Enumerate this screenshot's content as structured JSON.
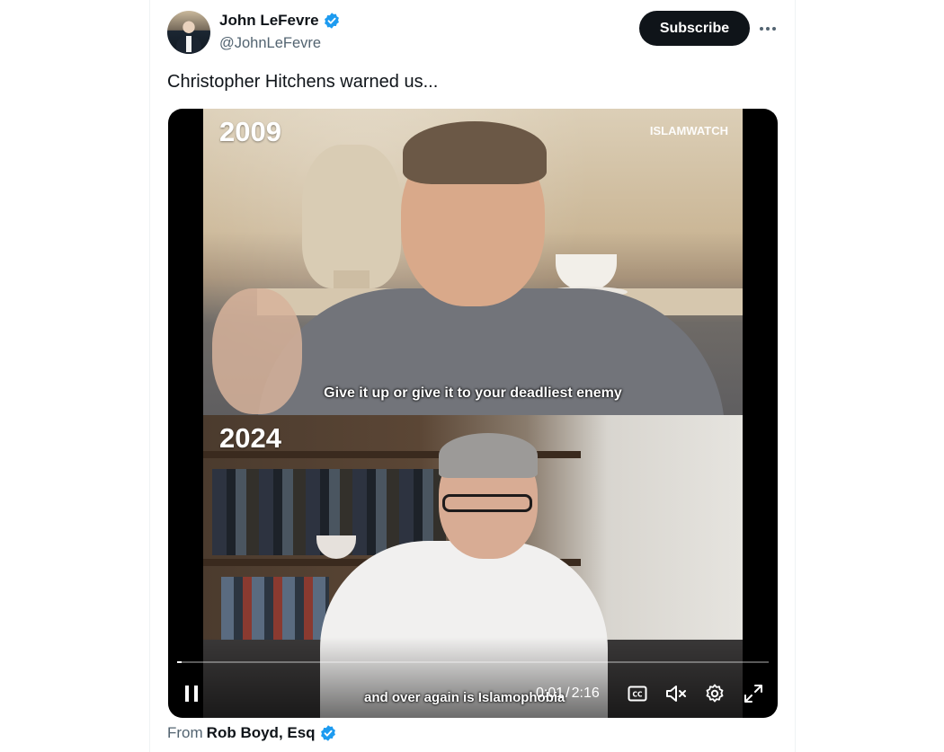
{
  "author": {
    "display_name": "John LeFevre",
    "handle": "@JohnLeFevre",
    "verified": true
  },
  "actions": {
    "subscribe_label": "Subscribe",
    "more_icon": "more-horizontal-icon"
  },
  "tweet": {
    "text": "Christopher Hitchens warned us..."
  },
  "video": {
    "top_year": "2009",
    "watermark": "ISLAMWATCH",
    "top_caption": "Give it up or give it to your deadliest enemy",
    "bottom_year": "2024",
    "bottom_caption": "and over again is Islamophobia",
    "current_time": "0:01",
    "separator": "/",
    "duration": "2:16",
    "progress_percent": 0.8,
    "icons": [
      "pause-icon",
      "captions-icon",
      "mute-icon",
      "settings-icon",
      "fullscreen-icon"
    ]
  },
  "source": {
    "prefix": "From",
    "name": "Rob Boyd, Esq",
    "verified": true
  },
  "colors": {
    "text_primary": "#0f1419",
    "text_secondary": "#536471",
    "verified_blue": "#1d9bf0",
    "button_dark": "#0f1419"
  }
}
